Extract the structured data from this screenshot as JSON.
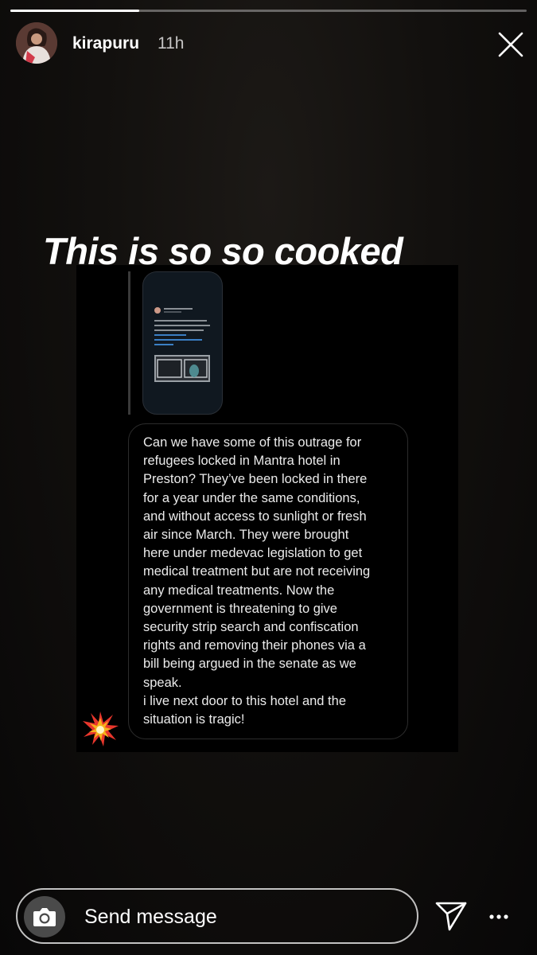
{
  "story": {
    "progress": 0.25,
    "username": "kirapuru",
    "time": "11h",
    "caption": "This is so so cooked"
  },
  "post": {
    "message_lines": [
      "Can we have some of this outrage for",
      "refugees locked in Mantra hotel in",
      "Preston? They’ve been locked in there",
      "for a year under the same conditions,",
      "and without access to sunlight or fresh",
      "air since March. They were brought",
      "here under medevac legislation to get",
      "medical treatment but are not receiving",
      "any medical treatments. Now the",
      "government is threatening to give",
      "security strip search and confiscation",
      "rights and removing their phones via a",
      "bill being argued in the senate as we",
      "speak.",
      "i live next door to this hotel and the",
      "situation is tragic!"
    ]
  },
  "footer": {
    "message_placeholder": "Send message"
  },
  "icons": {
    "close": "close-icon",
    "camera": "camera-icon",
    "send": "send-icon",
    "more": "more-icon",
    "reaction": "burst-emoji-icon"
  }
}
